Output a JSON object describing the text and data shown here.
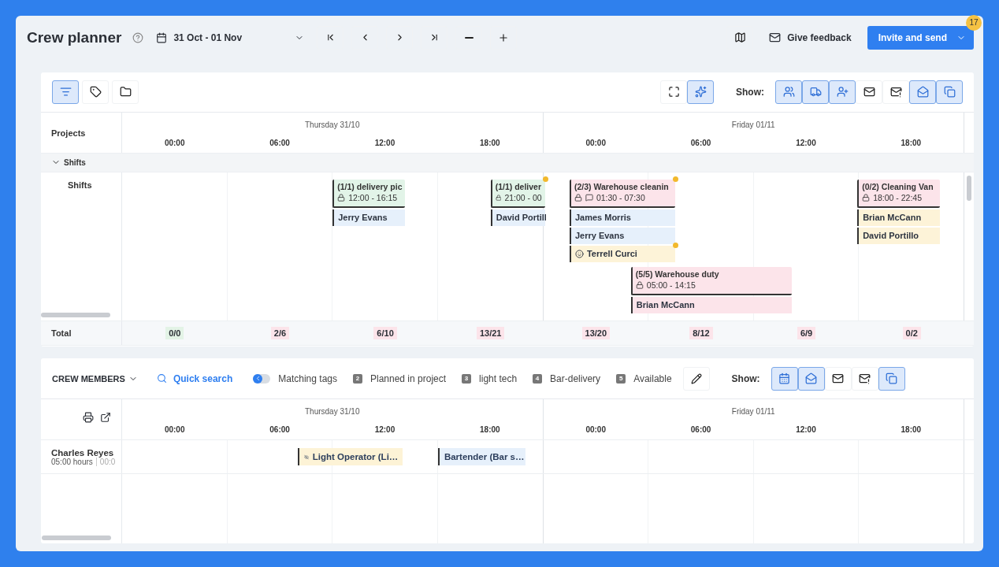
{
  "header": {
    "title": "Crew planner",
    "date_range": "31 Oct - 01 Nov",
    "feedback_label": "Give feedback",
    "primary_button": "Invite and send",
    "badge": "17"
  },
  "projects_panel": {
    "tools": [
      {
        "selected": true
      },
      {
        "selected": false
      },
      {
        "selected": false
      }
    ],
    "view_tools": [
      {
        "selected": false
      },
      {
        "selected": true
      }
    ],
    "show_label": "Show:",
    "show_toggles": [
      {
        "selected": true
      },
      {
        "selected": true
      },
      {
        "selected": true
      },
      {
        "selected": false
      },
      {
        "selected": false
      },
      {
        "selected": true
      },
      {
        "selected": true
      }
    ],
    "column_heading": "Projects",
    "days": [
      {
        "label": "Thursday 31/10",
        "hours": [
          "00:00",
          "06:00",
          "12:00",
          "18:00"
        ]
      },
      {
        "label": "Friday 01/11",
        "hours": [
          "00:00",
          "06:00",
          "12:00",
          "18:00"
        ]
      }
    ],
    "group": {
      "label": "Shifts",
      "expanded": true
    },
    "row_label": "Shifts",
    "shifts": [
      {
        "title": "(1/1) delivery pic",
        "time": "12:00 - 16:15",
        "color": "#e2f4e8",
        "has_note": false,
        "flagged": false,
        "people": [
          {
            "name": "Jerry Evans",
            "color": "#e6f0fb",
            "kind": "plain",
            "flagged": false
          }
        ]
      },
      {
        "title": "(1/1) deliver",
        "time": "21:00 - 00",
        "color": "#e2f4e8",
        "has_note": false,
        "flagged": true,
        "people": [
          {
            "name": "David Portill",
            "color": "#e6f0fb",
            "kind": "plain",
            "flagged": false
          }
        ]
      },
      {
        "title": "(2/3) Warehouse cleanin",
        "time": "01:30 - 07:30",
        "color": "#fce4ea",
        "has_note": true,
        "flagged": true,
        "people": [
          {
            "name": "James Morris",
            "color": "#e6f0fb",
            "kind": "plain",
            "flagged": false
          },
          {
            "name": "Jerry Evans",
            "color": "#e6f0fb",
            "kind": "plain",
            "flagged": false
          },
          {
            "name": "Terrell Curci",
            "color": "#fdf3d8",
            "kind": "marked",
            "flagged": true
          }
        ]
      },
      {
        "title": "(5/5) Warehouse duty",
        "time": "05:00 - 14:15",
        "color": "#fce4ea",
        "has_note": false,
        "flagged": false,
        "people": [
          {
            "name": "Brian McCann",
            "color": "#fce4ea",
            "kind": "plain",
            "flagged": false
          }
        ]
      },
      {
        "title": "(0/2) Cleaning Van",
        "time": "18:00 - 22:45",
        "color": "#fce4ea",
        "has_note": false,
        "flagged": false,
        "people": [
          {
            "name": "Brian McCann",
            "color": "#fdf3d8",
            "kind": "plain",
            "flagged": false
          },
          {
            "name": "David Portillo",
            "color": "#fdf3d8",
            "kind": "plain",
            "flagged": false
          }
        ]
      }
    ],
    "total_label": "Total",
    "totals": [
      {
        "value": "0/0",
        "color": "#e3f3e6"
      },
      {
        "value": "2/6",
        "color": "#fce4ea"
      },
      {
        "value": "6/10",
        "color": "#fce4ea"
      },
      {
        "value": "13/21",
        "color": "#fce4ea"
      },
      {
        "value": "13/20",
        "color": "#fce4ea"
      },
      {
        "value": "8/12",
        "color": "#fce4ea"
      },
      {
        "value": "6/9",
        "color": "#fce4ea"
      },
      {
        "value": "0/2",
        "color": "#fce4ea"
      }
    ]
  },
  "crew_panel": {
    "title": "CREW MEMBERS",
    "search": "Quick search",
    "filters": [
      {
        "kind": "handle",
        "label": "Matching tags"
      },
      {
        "kind": "numbered",
        "number": "2",
        "label": "Planned in project"
      },
      {
        "kind": "numbered",
        "number": "3",
        "label": "light tech"
      },
      {
        "kind": "numbered",
        "number": "4",
        "label": "Bar-delivery"
      },
      {
        "kind": "numbered",
        "number": "5",
        "label": "Available"
      }
    ],
    "show_label": "Show:",
    "show_toggles": [
      {
        "selected": true
      },
      {
        "selected": true
      },
      {
        "selected": false
      },
      {
        "selected": false
      },
      {
        "selected": true
      }
    ],
    "days": [
      {
        "label": "Thursday 31/10",
        "hours": [
          "00:00",
          "06:00",
          "12:00",
          "18:00"
        ]
      },
      {
        "label": "Friday 01/11",
        "hours": [
          "00:00",
          "06:00",
          "12:00",
          "18:00"
        ]
      }
    ],
    "members": [
      {
        "name": "Charles Reyes",
        "hours": "05:00 hours",
        "extra": "00:0",
        "assignments": [
          {
            "label": "Light Operator (Li…",
            "color": "#fdf3d6",
            "hidden": true
          },
          {
            "label": "Bartender (Bar s…",
            "color": "#e6f0fb",
            "hidden": false
          }
        ]
      }
    ]
  }
}
